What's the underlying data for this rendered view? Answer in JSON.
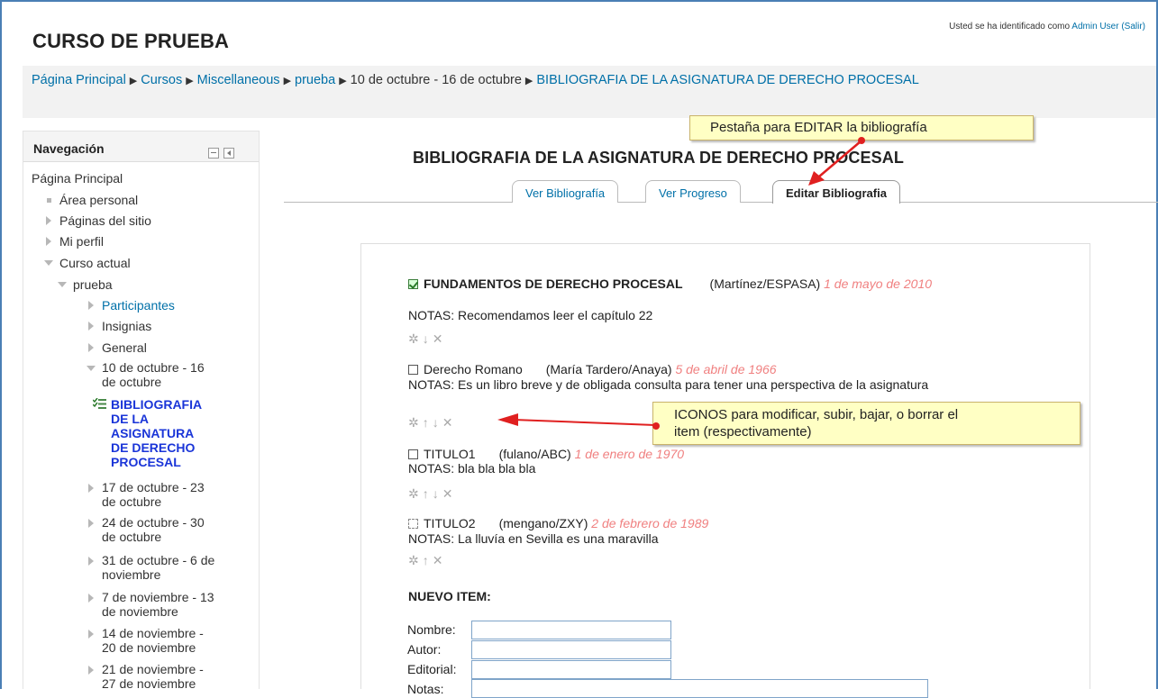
{
  "header": {
    "site_title": "CURSO DE PRUEBA",
    "login_prefix": "Usted se ha identificado como",
    "user_name": "Admin User",
    "logout": "(Salir)"
  },
  "breadcrumb": [
    "Página Principal",
    "Cursos",
    "Miscellaneous",
    "prueba",
    "10 de octubre - 16 de octubre",
    "BIBLIOGRAFIA DE LA ASIGNATURA DE DERECHO PROCESAL"
  ],
  "breadcrumb_separator": "▶",
  "nav": {
    "title": "Navegación",
    "items": [
      "Página Principal",
      "Área personal",
      "Páginas del sitio",
      "Mi perfil",
      "Curso actual",
      "prueba",
      "Participantes",
      "Insignias",
      "General",
      "10 de octubre - 16\nde octubre",
      "BIBLIOGRAFIA\nDE LA\nASIGNATURA\nDE DERECHO\nPROCESAL",
      "17 de octubre - 23\nde octubre",
      "24 de octubre - 30\nde octubre",
      "31 de octubre - 6 de\nnoviembre",
      "7 de noviembre - 13\nde noviembre",
      "14 de noviembre -\n20 de noviembre",
      "21 de noviembre -\n27 de noviembre"
    ]
  },
  "page": {
    "heading": "BIBLIOGRAFIA DE LA ASIGNATURA DE DERECHO PROCESAL",
    "tabs": [
      "Ver Bibliografía",
      "Ver Progreso",
      "Editar Bibliografia"
    ],
    "active_tab": "Editar Bibliografia"
  },
  "entries": [
    {
      "title": "FUNDAMENTOS DE DERECHO PROCESAL",
      "author": "(Martínez/ESPASA)",
      "date": "1 de mayo de 2010",
      "notes": "NOTAS: Recomendamos leer el capítulo 22",
      "status": "checked"
    },
    {
      "title": "Derecho Romano",
      "author": "(María Tardero/Anaya)",
      "date": "5 de abril de 1966",
      "notes": "NOTAS: Es un libro breve y de obligada consulta para tener una perspectiva de la asignatura",
      "status": "unchecked"
    },
    {
      "title": "TITULO1",
      "author": "(fulano/ABC)",
      "date": "1 de enero de 1970",
      "notes": "NOTAS: bla bla bla bla",
      "status": "unchecked"
    },
    {
      "title": "TITULO2",
      "author": "(mengano/ZXY)",
      "date": "2 de febrero de 1989",
      "notes": "NOTAS: La lluvía en Sevilla es una maravilla",
      "status": "dashed"
    }
  ],
  "icons": {
    "edit": "gear-icon",
    "up": "arrow-up-icon",
    "down": "arrow-down-icon",
    "delete": "delete-icon"
  },
  "new_item": {
    "heading": "NUEVO ITEM:",
    "labels": {
      "name": "Nombre:",
      "author": "Autor:",
      "publisher": "Editorial:",
      "notes": "Notas:"
    },
    "values": {
      "name": "",
      "author": "",
      "publisher": "",
      "notes": ""
    }
  },
  "annotations": {
    "tab_note": "Pestaña para EDITAR la bibliografía",
    "icons_note": "ICONOS para modificar, subir, bajar, o borrar el\nitem (respectivamente)"
  },
  "colors": {
    "link": "#0070a8",
    "active_nav": "#1a35d8",
    "date": "#f08080",
    "note_bg": "#ffffc4",
    "arrow": "#e02020"
  }
}
